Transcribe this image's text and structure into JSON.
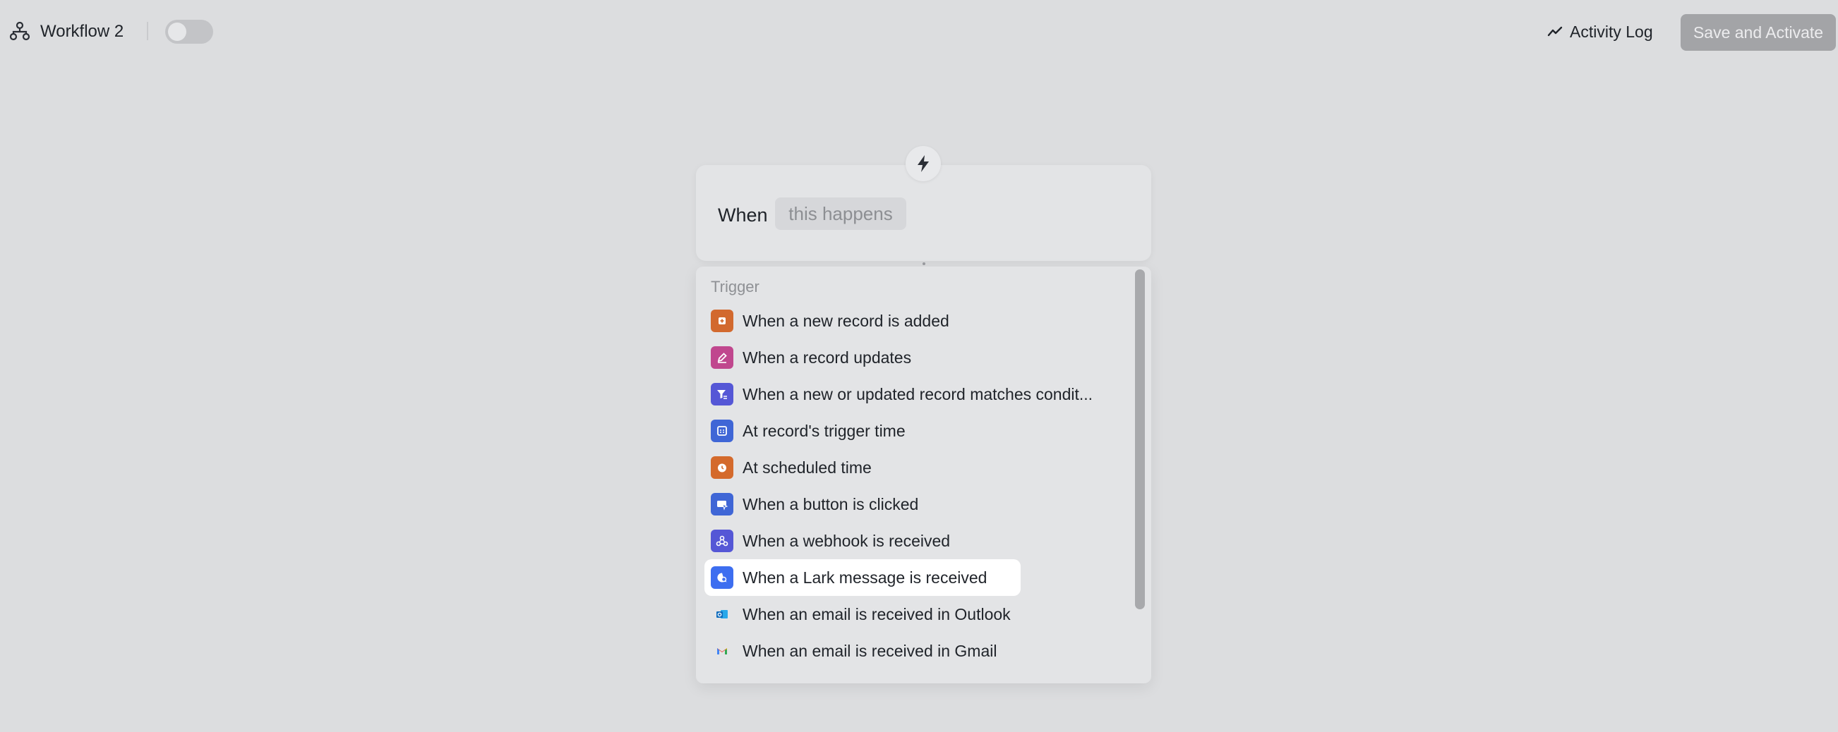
{
  "header": {
    "workflow_title": "Workflow 2",
    "activity_log_label": "Activity Log",
    "save_label": "Save and Activate",
    "toggle_on": false
  },
  "trigger_card": {
    "when_label": "When",
    "placeholder_chip": "this happens"
  },
  "dropdown": {
    "section_title": "Trigger",
    "items": [
      {
        "label": "When a new record is added",
        "icon": "add-record-icon",
        "color": "#d2692e"
      },
      {
        "label": "When a record updates",
        "icon": "edit-record-icon",
        "color": "#c0478e"
      },
      {
        "label": "When a new or updated record matches condit...",
        "icon": "filter-icon",
        "color": "#5557d6"
      },
      {
        "label": "At record's trigger time",
        "icon": "calendar-icon",
        "color": "#3f66d6"
      },
      {
        "label": "At scheduled time",
        "icon": "clock-icon",
        "color": "#d46a2c"
      },
      {
        "label": "When a button is clicked",
        "icon": "button-click-icon",
        "color": "#3f66d6"
      },
      {
        "label": "When a webhook is received",
        "icon": "webhook-icon",
        "color": "#5557d6"
      },
      {
        "label": "When a Lark message is received",
        "icon": "lark-message-icon",
        "color": "#3d6ef0"
      },
      {
        "label": "When an email is received in Outlook",
        "icon": "outlook-icon",
        "color": "#0f6cbd"
      },
      {
        "label": "When an email is received in Gmail",
        "icon": "gmail-icon",
        "color": "#ea4335"
      }
    ],
    "active_index": 7
  }
}
